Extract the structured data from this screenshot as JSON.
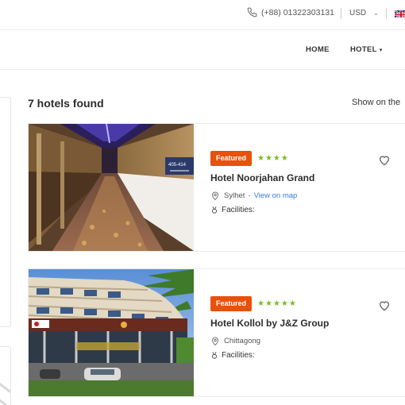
{
  "topbar": {
    "phone": "(+88) 01322303131",
    "currency": "USD",
    "icons": {
      "phone": "phone-icon",
      "chevron": "chevron-down-icon",
      "flag": "uk-flag-icon"
    }
  },
  "nav": {
    "items": [
      {
        "label": "HOME"
      },
      {
        "label": "HOTEL"
      }
    ]
  },
  "results": {
    "count_label": "7 hotels found",
    "show_map_label": "Show on the"
  },
  "hotels": [
    {
      "badge": "Featured",
      "rating": 4,
      "stars": "★★★★",
      "name": "Hotel Noorjahan Grand",
      "city": "Sylhet",
      "map_link": "View on map",
      "facilities_label": "Facilities:",
      "room_sign": "405-414"
    },
    {
      "badge": "Featured",
      "rating": 5,
      "stars": "★★★★★",
      "name": "Hotel Kollol by J&Z Group",
      "city": "Chittagong",
      "facilities_label": "Facilities:"
    }
  ],
  "colors": {
    "accent": "#e8510c",
    "stars": "#7cbb20",
    "link": "#3b7dd8"
  }
}
